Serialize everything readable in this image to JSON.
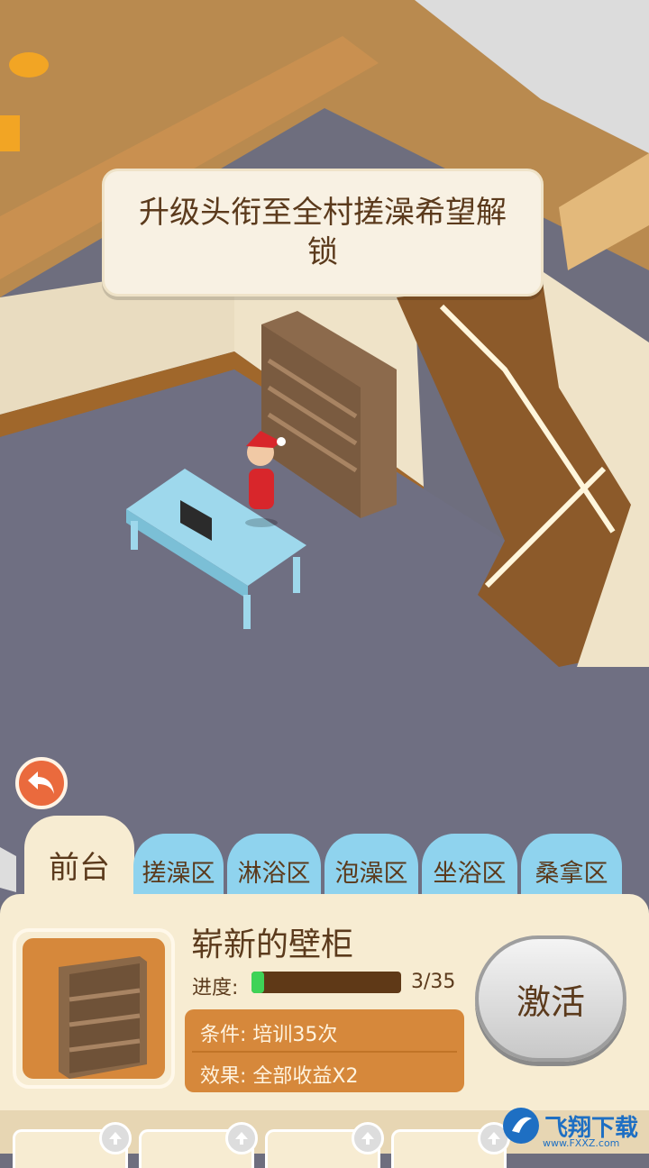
{
  "tooltip": {
    "text": "升级头衔至全村搓澡希望解锁"
  },
  "tabs": [
    {
      "label": "前台",
      "active": true
    },
    {
      "label": "搓澡区",
      "active": false
    },
    {
      "label": "淋浴区",
      "active": false
    },
    {
      "label": "泡澡区",
      "active": false
    },
    {
      "label": "坐浴区",
      "active": false
    },
    {
      "label": "桑拿区",
      "active": false
    }
  ],
  "item": {
    "name": "崭新的壁柜",
    "progress_label": "进度:",
    "progress_current": 3,
    "progress_total": 35,
    "progress_text": "3/35",
    "condition": "条件:  培训35次",
    "effect": "效果:  全部收益X2"
  },
  "activate_label": "激活",
  "watermark": {
    "brand": "飞翔下载",
    "url": "www.FXXZ.com"
  },
  "colors": {
    "tab_active": "#f7ecd2",
    "tab_inactive": "#8fd3ee",
    "progress": "#3ed357",
    "accent": "#ea6a3d"
  }
}
